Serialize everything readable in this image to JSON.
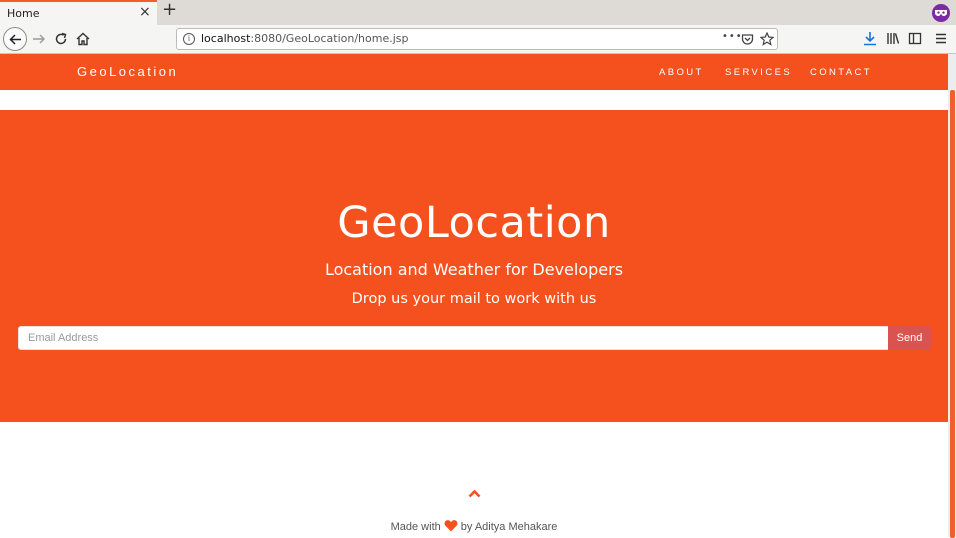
{
  "browser": {
    "tab_title": "Home",
    "tab_close": "×",
    "new_tab": "+",
    "url_host": "localhost",
    "url_rest": ":8080/GeoLocation/home.jsp",
    "url_more": "•••",
    "icons": [
      "back-icon",
      "forward-icon",
      "reload-icon",
      "home-icon",
      "info-icon",
      "pocket-icon",
      "bookmark-star-icon",
      "download-icon",
      "library-icon",
      "sidebar-icon",
      "menu-icon",
      "extension-mask-icon"
    ]
  },
  "site": {
    "brand": "GeoLocation",
    "nav": [
      "ABOUT",
      "SERVICES",
      "CONTACT"
    ],
    "accent": "#f4511e"
  },
  "hero": {
    "title": "GeoLocation",
    "subtitle": "Location and Weather for Developers",
    "cta": "Drop us your mail to work with us",
    "email_placeholder": "Email Address",
    "send_label": "Send",
    "send_color": "#d9534f"
  },
  "footer": {
    "made_with": "Made with",
    "by": "by Aditya Mehakare"
  }
}
